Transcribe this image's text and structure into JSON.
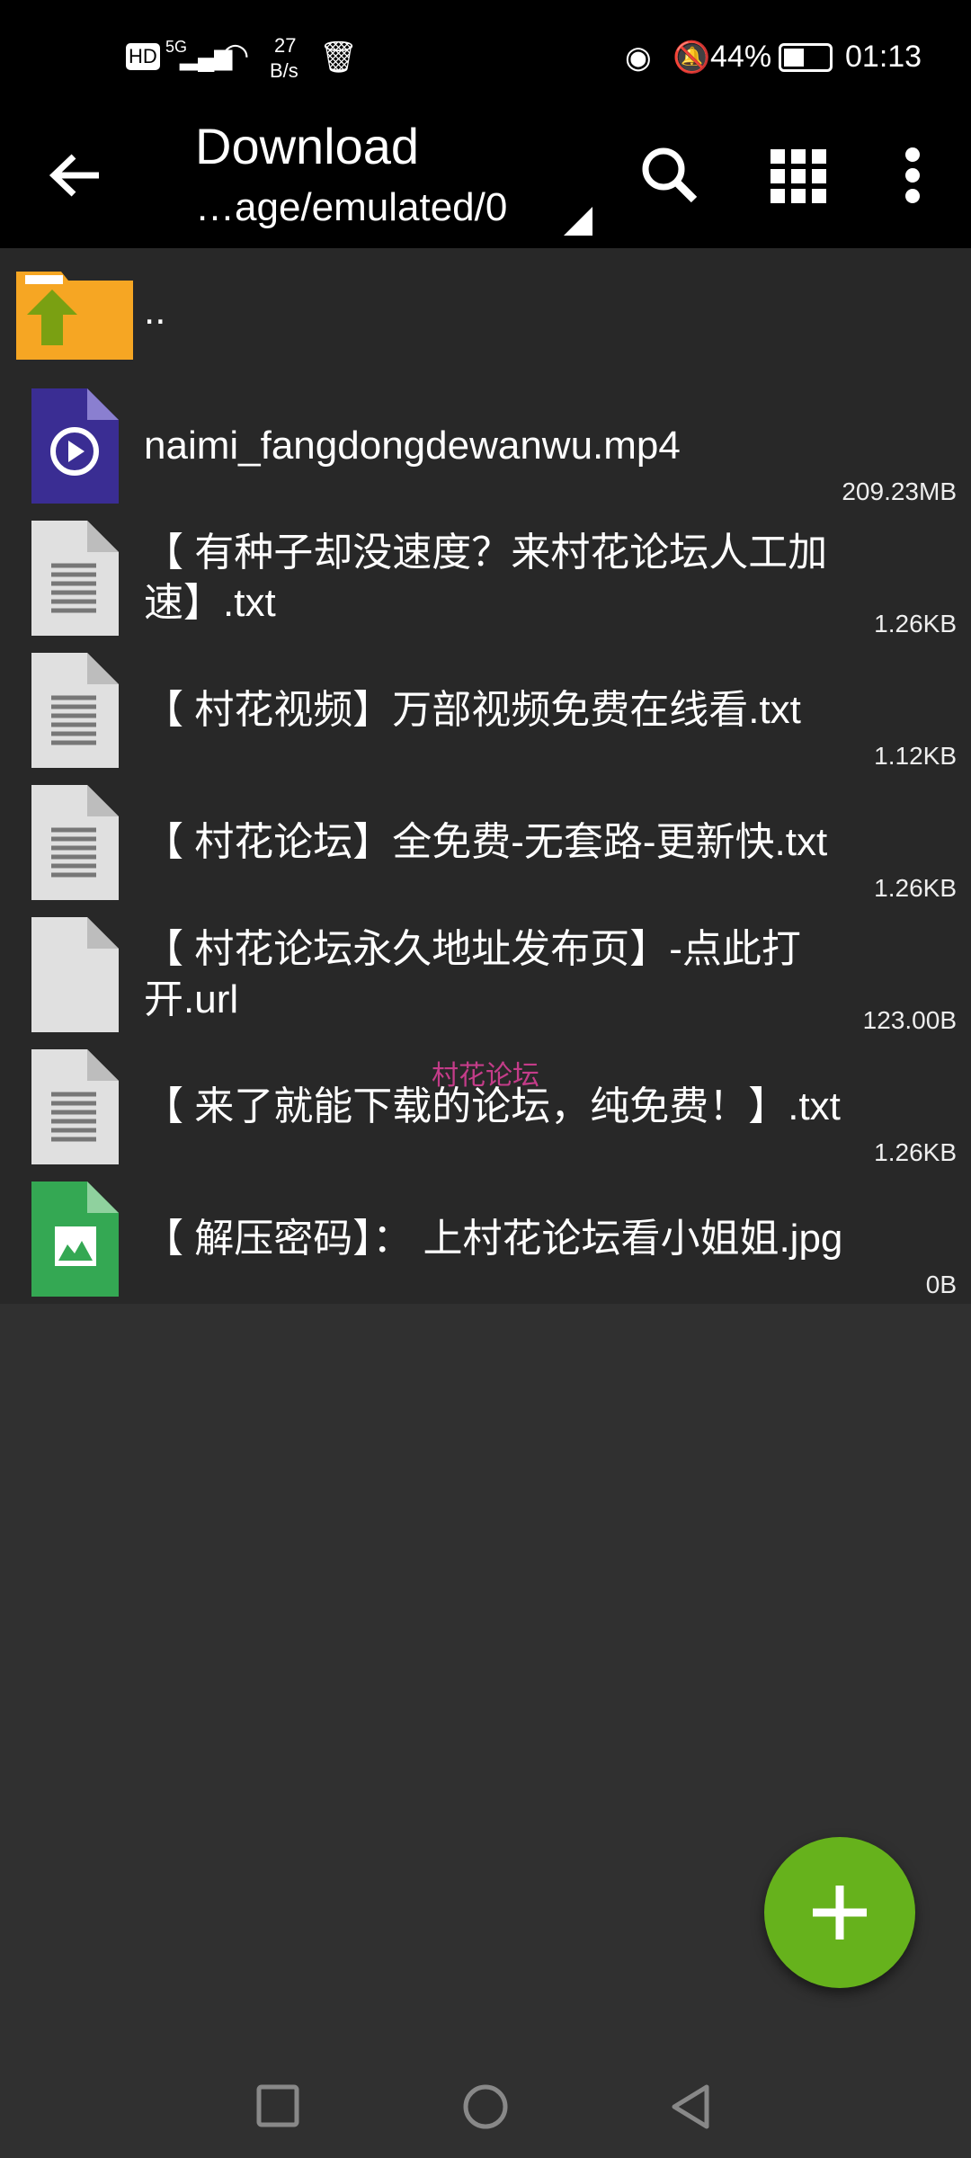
{
  "status_bar": {
    "hd": "HD",
    "network": "5G",
    "speed_value": "27",
    "speed_unit": "B/s",
    "battery": "44%",
    "time": "01:13",
    "battery_level": 0.44
  },
  "toolbar": {
    "title": "Download",
    "path": "…age/emulated/0",
    "icons": [
      "back-arrow-icon",
      "search-icon",
      "grid-view-icon",
      "more-vert-icon"
    ]
  },
  "files": [
    {
      "name": "..",
      "size": "",
      "type": "parent-folder"
    },
    {
      "name": "naimi_fangdongdewanwu.mp4",
      "size": "209.23MB",
      "type": "video"
    },
    {
      "name": "【 有种子却没速度？来村花论坛人工加速】.txt",
      "size": "1.26KB",
      "type": "text"
    },
    {
      "name": "【 村花视频】万部视频免费在线看.txt",
      "size": "1.12KB",
      "type": "text"
    },
    {
      "name": "【 村花论坛】全免费-无套路-更新快.txt",
      "size": "1.26KB",
      "type": "text"
    },
    {
      "name": "【 村花论坛永久地址发布页】-点此打开.url",
      "size": "123.00B",
      "type": "blank"
    },
    {
      "name": "【 来了就能下载的论坛，纯免费！】.txt",
      "size": "1.26KB",
      "type": "text"
    },
    {
      "name": "【 解压密码】： 上村花论坛看小姐姐.jpg",
      "size": "0B",
      "type": "image"
    }
  ],
  "watermark": "村花论坛",
  "fab": {
    "icon": "plus-icon",
    "color": "#66b21c"
  }
}
